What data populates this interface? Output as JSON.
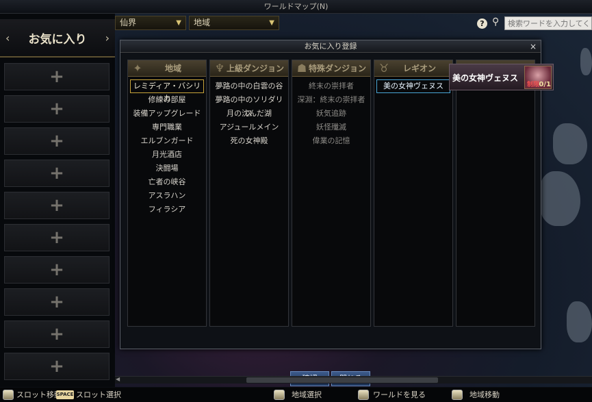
{
  "window_title": "ワールドマップ(N)",
  "sidebar": {
    "title": "お気に入り",
    "prev_icon": "chevron-left-icon",
    "next_icon": "chevron-right-icon",
    "slots": [
      "+",
      "+",
      "+",
      "+",
      "+",
      "+",
      "+",
      "+",
      "+",
      "+"
    ]
  },
  "top_bar": {
    "region_select": "仙界",
    "area_select": "地域",
    "help_label": "?",
    "search_icon": "search-icon",
    "search_placeholder": "検索ワードを入力してく"
  },
  "dialog": {
    "title": "お気に入り登録",
    "close": "×",
    "columns": [
      {
        "header": "地域",
        "icon": "crest-icon",
        "items": [
          "レミディア・バシリカ",
          "修練の部屋",
          "装備アップグレード",
          "専門職業",
          "エルブンガード",
          "月光酒店",
          "決闘場",
          "亡者の峡谷",
          "アスラハン",
          "フィラシア"
        ]
      },
      {
        "header": "上級ダンジョン",
        "icon": "helm-icon",
        "items": [
          "夢路の中の白雲の谷",
          "夢路の中のソリダリス",
          "月の沈んだ湖",
          "アジュールメイン",
          "死の女神殿"
        ]
      },
      {
        "header": "特殊ダンジョン",
        "icon": "mask-icon",
        "items": [
          "終末の崇拝者",
          "深淵：終末の崇拝者",
          "妖気追跡",
          "妖怪殲滅",
          "偉業の記憶"
        ]
      },
      {
        "header": "レギオン",
        "icon": "horns-icon",
        "items": [
          "美の女神ヴェヌス"
        ]
      },
      {
        "header": "",
        "icon": "",
        "items": []
      }
    ],
    "confirm_label": "確認",
    "close_label": "閉じる"
  },
  "tooltip": {
    "name": "美の女神ヴェヌス",
    "status": "制限",
    "count": "0/1"
  },
  "bottom_bar": {
    "slot_move": "スロット移動",
    "space_key": "SPACE",
    "slot_select": "スロット選択",
    "area_select": "地域選択",
    "world_view": "ワールドを見る",
    "area_move": "地域移動"
  }
}
